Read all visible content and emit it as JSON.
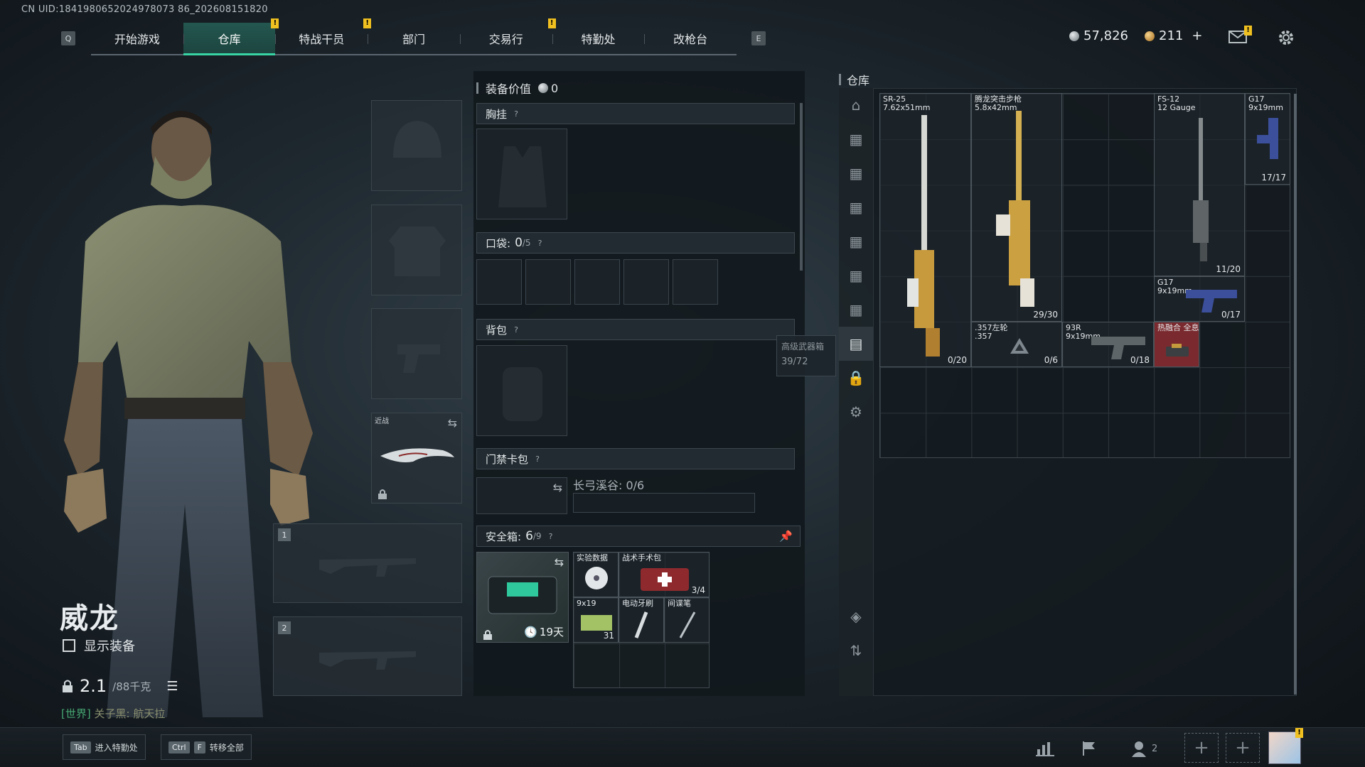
{
  "uid": "CN UID:1841980652024978073 86_202608151820",
  "nav": {
    "left_key": "Q",
    "right_key": "E",
    "tabs": [
      {
        "label": "开始游戏",
        "active": false,
        "badge": ""
      },
      {
        "label": "仓库",
        "active": true,
        "badge": ""
      },
      {
        "label": "特战干员",
        "active": false,
        "badge": "!"
      },
      {
        "label": "部门",
        "active": false,
        "badge": "!"
      },
      {
        "label": "交易行",
        "active": false,
        "badge": ""
      },
      {
        "label": "特勤处",
        "active": false,
        "badge": "!"
      },
      {
        "label": "改枪台",
        "active": false,
        "badge": ""
      }
    ]
  },
  "currency": {
    "silver": "57,826",
    "gold": "211",
    "plus": "+",
    "mail_badge": "!"
  },
  "character": {
    "name": "威龙",
    "show_gear_label": "显示装备",
    "weight": "2.1",
    "weight_max": "/88千克",
    "chat_channel": "[世界]",
    "chat_text": "关子黑: 航天拉"
  },
  "equipment": {
    "melee_label": "近战",
    "weapon_slot_1": "1",
    "weapon_slot_2": "2"
  },
  "loadout": {
    "value_label": "装备价值",
    "value": "0",
    "chest_label": "胸挂",
    "pocket_label": "口袋:",
    "pocket_count": "0",
    "pocket_max": "/5",
    "backpack_label": "背包",
    "keycard_label": "门禁卡包",
    "keycard_map": "长弓溪谷: 0/6",
    "safebox_label": "安全箱:",
    "safebox_count": "6",
    "safebox_max": "/9",
    "safebox_timer": "19天",
    "safebox_items": [
      {
        "name": "实验数据",
        "count": ""
      },
      {
        "name": "战术手术包",
        "count": "3/4"
      },
      {
        "name": "9x19",
        "count": "31"
      },
      {
        "name": "电动牙刷",
        "count": ""
      },
      {
        "name": "间谍笔",
        "count": ""
      }
    ]
  },
  "tooltip": {
    "name": "高级武器箱",
    "count": "39/72"
  },
  "warehouse": {
    "title": "仓库",
    "items": [
      {
        "name": "SR-25\n7.62x51mm",
        "count": "0/20"
      },
      {
        "name": "腾龙突击步枪\n5.8x42mm",
        "count": "29/30"
      },
      {
        "name": "FS-12\n12 Gauge",
        "count": "11/20"
      },
      {
        "name": "G17\n9x19mm",
        "count": "17/17"
      },
      {
        "name": "G17\n9x19mm",
        "count": "0/17"
      },
      {
        "name": ".357左轮\n.357",
        "count": "0/6"
      },
      {
        "name": "93R\n9x19mm",
        "count": "0/18"
      },
      {
        "name": "热融合 全息",
        "count": ""
      }
    ]
  },
  "bottom": {
    "hint1_key": "Tab",
    "hint1_label": "进入特勤处",
    "hint2_key1": "Ctrl",
    "hint2_key2": "F",
    "hint2_label": "转移全部",
    "friends_count": "2",
    "avatar_badge": "!"
  },
  "colors": {
    "accent": "#39d4a4",
    "badge": "#f0c020",
    "chat": "#47a874",
    "hot_item": "#7a2a2e"
  }
}
